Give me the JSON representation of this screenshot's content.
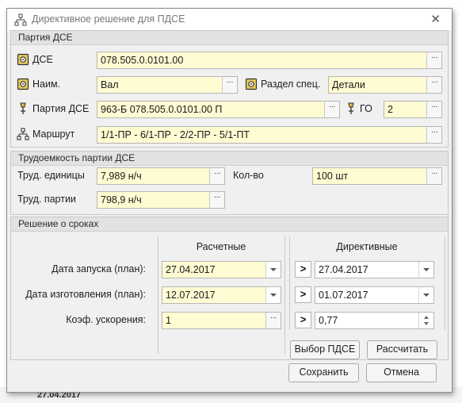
{
  "window": {
    "title": "Директивное решение для ПДСЕ",
    "close_glyph": "✕"
  },
  "sections": {
    "party": "Партия ДСЕ",
    "labor": "Трудоемкость партии ДСЕ",
    "dates": "Решение о сроках"
  },
  "party": {
    "dse_label": "ДСЕ",
    "dse_value": "078.505.0.0101.00",
    "name_label": "Наим.",
    "name_value": "Вал",
    "spec_label": "Раздел спец.",
    "spec_value": "Детали",
    "batch_label": "Партия ДСЕ",
    "batch_value": "963-Б 078.505.0.0101.00 П",
    "go_label": "ГО",
    "go_value": "2",
    "route_label": "Маршрут",
    "route_value": "1/1-ПР - 6/1-ПР - 2/2-ПР - 5/1-ПТ"
  },
  "labor": {
    "unit_label": "Труд. единицы",
    "unit_value": "7,989 н/ч",
    "qty_label": "Кол-во",
    "qty_value": "100 шт",
    "batch_label": "Труд. партии",
    "batch_value": "798,9 н/ч"
  },
  "dates": {
    "calc_header": "Расчетные",
    "dir_header": "Директивные",
    "start_label": "Дата запуска (план):",
    "start_calc": "27.04.2017",
    "start_dir": "27.04.2017",
    "finish_label": "Дата изготовления (план):",
    "finish_calc": "12.07.2017",
    "finish_dir": "01.07.2017",
    "coef_label": "Коэф. ускорения:",
    "coef_calc": "1",
    "coef_dir": "0,77"
  },
  "buttons": {
    "ellipsis": "···",
    "arrow": ">",
    "select_pdse": "Выбор ПДСЕ",
    "calculate": "Рассчитать",
    "save": "Сохранить",
    "cancel": "Отмена"
  },
  "background": {
    "row_date": "27.04.2017"
  },
  "colors": {
    "field_bg": "#fffbd2",
    "section_header_bg": "#e2e2e2",
    "dialog_bg": "#f0f0f0"
  }
}
